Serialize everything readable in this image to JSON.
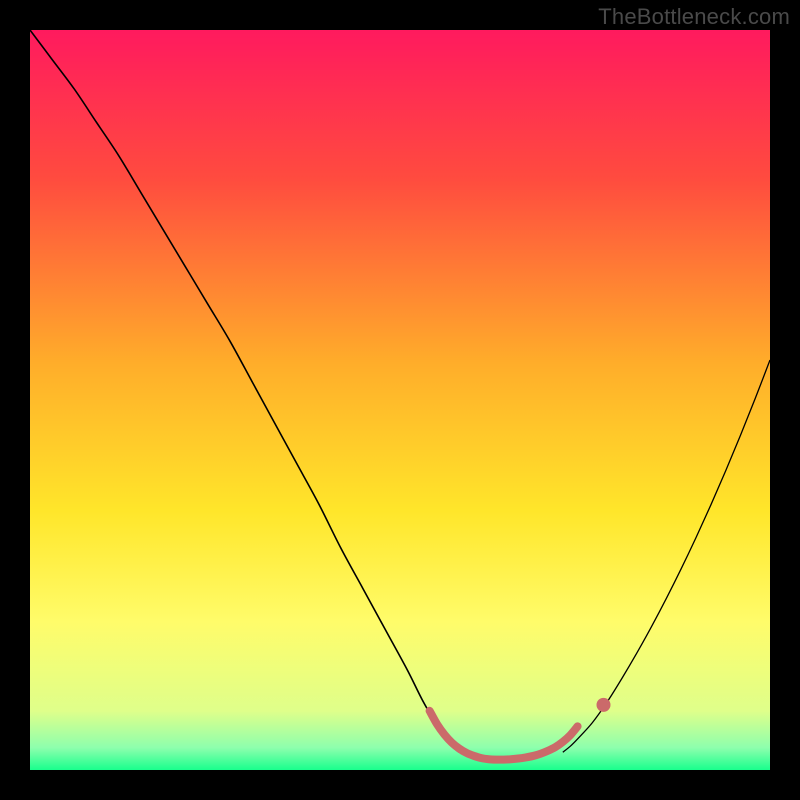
{
  "watermark": "TheBottleneck.com",
  "chart_data": {
    "type": "line",
    "title": "",
    "xlabel": "",
    "ylabel": "",
    "xlim": [
      0,
      100
    ],
    "ylim": [
      0,
      100
    ],
    "grid": false,
    "legend": false,
    "background_gradient_stops": [
      {
        "pos": 0.0,
        "color": "#ff1a5e"
      },
      {
        "pos": 0.2,
        "color": "#ff4b3f"
      },
      {
        "pos": 0.45,
        "color": "#ffad2a"
      },
      {
        "pos": 0.65,
        "color": "#ffe62a"
      },
      {
        "pos": 0.8,
        "color": "#fffc6a"
      },
      {
        "pos": 0.92,
        "color": "#dfff8a"
      },
      {
        "pos": 0.97,
        "color": "#8dffad"
      },
      {
        "pos": 1.0,
        "color": "#19ff8d"
      }
    ],
    "series": [
      {
        "name": "left-curve",
        "stroke": "#000",
        "width": 1.6,
        "x": [
          0,
          3,
          6,
          9,
          12,
          15,
          18,
          21,
          24,
          27,
          30,
          33,
          36,
          39,
          42,
          45,
          48,
          51,
          53,
          55,
          56,
          57,
          58
        ],
        "y": [
          100,
          96,
          92,
          87.5,
          83,
          78,
          73,
          68,
          63,
          58,
          52.5,
          47,
          41.5,
          36,
          30,
          24.5,
          19,
          13.5,
          9.5,
          6,
          4.4,
          3.2,
          2.4
        ]
      },
      {
        "name": "right-curve",
        "stroke": "#000",
        "width": 1.3,
        "x": [
          72,
          73,
          74,
          76,
          78,
          80,
          82,
          84,
          86,
          88,
          90,
          92,
          94,
          96,
          98,
          100
        ],
        "y": [
          2.4,
          3.2,
          4.2,
          6.4,
          9.2,
          12.4,
          15.8,
          19.4,
          23.2,
          27.2,
          31.4,
          35.8,
          40.4,
          45.2,
          50.2,
          55.4
        ]
      },
      {
        "name": "valley-highlight",
        "stroke": "#cb6a6a",
        "width": 8,
        "linecap": "round",
        "x": [
          54,
          55,
          56,
          57,
          58,
          59,
          60,
          61,
          62,
          63,
          64,
          65,
          66,
          67,
          68,
          69,
          70,
          71,
          72,
          73,
          74
        ],
        "y": [
          8.0,
          6.2,
          4.8,
          3.7,
          2.9,
          2.3,
          1.9,
          1.6,
          1.45,
          1.4,
          1.4,
          1.45,
          1.55,
          1.7,
          1.9,
          2.2,
          2.6,
          3.1,
          3.8,
          4.7,
          5.9
        ]
      },
      {
        "name": "valley-dot",
        "type": "scatter",
        "fill": "#cb6a6a",
        "r": 7,
        "x": [
          77.5
        ],
        "y": [
          8.8
        ]
      }
    ]
  }
}
